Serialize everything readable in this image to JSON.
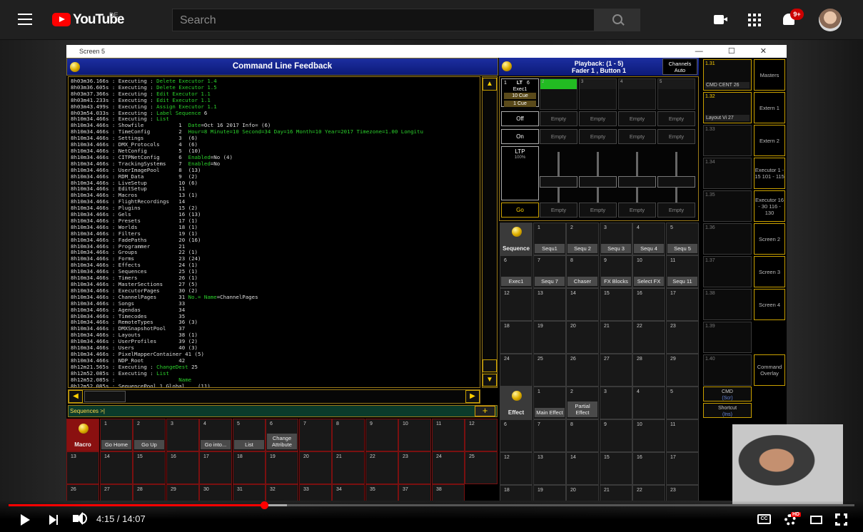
{
  "youtube": {
    "logo_text": "YouTube",
    "logo_country": "DE",
    "search_placeholder": "Search",
    "notification_count": "9+",
    "current_time": "4:15",
    "duration": "14:07",
    "time_display": "4:15 / 14:07",
    "progress": 0.301,
    "buffered": 0.33,
    "hd_badge": "HD",
    "cc_label": "CC"
  },
  "window": {
    "title": "Screen 5",
    "controls": "—  ☐  ✕"
  },
  "command_feedback": {
    "title": "Command Line Feedback",
    "lines": [
      [
        "8h03m36.166s : Executing : ",
        "Delete Executor 1.4",
        ""
      ],
      [
        "8h03m36.605s : Executing : ",
        "Delete Executor 1.5",
        ""
      ],
      [
        "8h03m37.366s : Executing : ",
        "Edit Executor 1.1",
        ""
      ],
      [
        "8h03m41.233s : Executing : ",
        "Edit Executor 1.1",
        ""
      ],
      [
        "8h03m43.499s : Executing : ",
        "Assign Executor 1.1",
        ""
      ],
      [
        "8h03m54.033s : Executing : ",
        "Label Sequence",
        " 6"
      ],
      [
        "8h10m34.466s : Executing : ",
        "List",
        ""
      ],
      [
        "8h10m34.466s : Showfile           1  ",
        "Date",
        "=Oct 16 2017 Info= (6)"
      ],
      [
        "8h10m34.466s : TimeConfig         2  ",
        "Hour=8 Minute=10 Second=34 Day=16 Month=10 Year=2017 Timezone=1.00 Longitu",
        ""
      ],
      [
        "8h10m34.466s : Settings           3  ",
        "",
        "(6)"
      ],
      [
        "8h10m34.466s : DMX_Protocols      4  ",
        "",
        "(6)"
      ],
      [
        "8h10m34.466s : NetConfig          5  ",
        "",
        "(10)"
      ],
      [
        "8h10m34.466s : CITPNetConfig      6  ",
        "Enabled",
        "=No (4)"
      ],
      [
        "8h10m34.466s : TrackingSystems    7  ",
        "Enabled",
        "=No"
      ],
      [
        "8h10m34.466s : UserImagePool      8  ",
        "",
        "(13)"
      ],
      [
        "8h10m34.466s : RDM_Data           9  ",
        "",
        "(2)"
      ],
      [
        "8h10m34.466s : LiveSetup          10 ",
        "",
        "(6)"
      ],
      [
        "8h10m34.466s : EditSetup          11",
        "",
        ""
      ],
      [
        "8h10m34.466s : Macros             13 ",
        "",
        "(1)"
      ],
      [
        "8h10m34.466s : FlightRecordings   14",
        "",
        ""
      ],
      [
        "8h10m34.466s : Plugins            15 ",
        "",
        "(2)"
      ],
      [
        "8h10m34.466s : Gels               16 ",
        "",
        "(13)"
      ],
      [
        "8h10m34.466s : Presets            17 ",
        "",
        "(1)"
      ],
      [
        "8h10m34.466s : Worlds             18 ",
        "",
        "(1)"
      ],
      [
        "8h10m34.466s : Filters            19 ",
        "",
        "(1)"
      ],
      [
        "8h10m34.466s : FadePaths          20 ",
        "",
        "(16)"
      ],
      [
        "8h10m34.466s : Programmer         21",
        "",
        ""
      ],
      [
        "8h10m34.466s : Groups             22 ",
        "",
        "(1)"
      ],
      [
        "8h10m34.466s : Forms              23 ",
        "",
        "(24)"
      ],
      [
        "8h10m34.466s : Effects            24 ",
        "",
        "(1)"
      ],
      [
        "8h10m34.466s : Sequences          25 ",
        "",
        "(1)"
      ],
      [
        "8h10m34.466s : Timers             26 ",
        "",
        "(1)"
      ],
      [
        "8h10m34.466s : MasterSections     27 ",
        "",
        "(5)"
      ],
      [
        "8h10m34.466s : ExecutorPages      30 ",
        "",
        "(2)"
      ],
      [
        "8h10m34.466s : ChannelPages       31 ",
        "No.= Name",
        "=ChannelPages"
      ],
      [
        "8h10m34.466s : Songs              33",
        "",
        ""
      ],
      [
        "8h10m34.466s : Agendas            34",
        "",
        ""
      ],
      [
        "8h10m34.466s : Timecodes          35",
        "",
        ""
      ],
      [
        "8h10m34.466s : RemoteTypes        36 ",
        "",
        "(3)"
      ],
      [
        "8h10m34.466s : DMXSnapshotPool    37",
        "",
        ""
      ],
      [
        "8h10m34.466s : Layouts            38 ",
        "",
        "(1)"
      ],
      [
        "8h10m34.466s : UserProfiles       39 ",
        "",
        "(2)"
      ],
      [
        "8h10m34.466s : Users              40 ",
        "",
        "(3)"
      ],
      [
        "8h10m34.466s : PixelMapperContainer 41 ",
        "",
        "(5)"
      ],
      [
        "8h10m34.466s : NDP_Root           42",
        "",
        ""
      ],
      [
        "8h12m21.565s : Executing : ",
        "ChangeDest",
        " 25"
      ],
      [
        "8h12m52.085s : Executing : ",
        "List",
        ""
      ],
      [
        "8h12m52.085s :                    ",
        "Name",
        ""
      ],
      [
        "8h12m52.085s : SequencePool 1 Global    (11)",
        "",
        ""
      ]
    ],
    "command_prompt": "Sequences >|"
  },
  "macros": {
    "header": "Macro",
    "items": [
      {
        "n": "1",
        "label": "Go Home"
      },
      {
        "n": "2",
        "label": "Go Up"
      },
      {
        "n": "3",
        "label": ""
      },
      {
        "n": "4",
        "label": "Go into..."
      },
      {
        "n": "5",
        "label": "List"
      },
      {
        "n": "6",
        "label": "Change Attribute"
      },
      {
        "n": "7",
        "label": ""
      },
      {
        "n": "8",
        "label": ""
      },
      {
        "n": "9",
        "label": ""
      },
      {
        "n": "10",
        "label": ""
      },
      {
        "n": "11",
        "label": ""
      },
      {
        "n": "12",
        "label": ""
      }
    ],
    "row2": [
      "13",
      "14",
      "15",
      "16",
      "17",
      "18",
      "19",
      "20",
      "21",
      "22",
      "23",
      "24",
      "25"
    ],
    "row3": [
      "26",
      "27",
      "28",
      "29",
      "30",
      "31",
      "32",
      "33",
      "34",
      "35",
      "37",
      "38"
    ]
  },
  "playback": {
    "title_line1": "Playback: (1 - 5)",
    "title_line2": "Fader  1 , Button  1",
    "channels_label": "Channels",
    "channels_mode": "Auto",
    "exec_num": "1",
    "exec_lt": "LT",
    "exec_count": "6",
    "exec_name": "Exec1",
    "exec_cue1": "10 Cue",
    "exec_cue2": "1 Cue",
    "off_label": "Off",
    "on_label": "On",
    "ltp_label": "LTP",
    "ltp_value": "100%",
    "go_label": "Go",
    "empty_label": "Empty",
    "slot_nums": [
      "2",
      "3",
      "4",
      "5"
    ]
  },
  "executors": {
    "sequence_label": "Sequence",
    "effect_label": "Effect",
    "row1": [
      {
        "n": "1",
        "label": "Sequ1"
      },
      {
        "n": "2",
        "label": "Sequ 2"
      },
      {
        "n": "3",
        "label": "Sequ 3"
      },
      {
        "n": "4",
        "label": "Sequ 4"
      },
      {
        "n": "5",
        "label": "Sequ 5"
      }
    ],
    "row2": [
      {
        "n": "6",
        "label": "Exec1"
      },
      {
        "n": "7",
        "label": "Sequ 7"
      },
      {
        "n": "8",
        "label": "Chaser"
      },
      {
        "n": "9",
        "label": "FX Blocks"
      },
      {
        "n": "10",
        "label": "Select FX"
      },
      {
        "n": "11",
        "label": "Sequ 11"
      }
    ],
    "row3": [
      "12",
      "13",
      "14",
      "15",
      "16",
      "17"
    ],
    "row4": [
      "18",
      "19",
      "20",
      "21",
      "22",
      "23"
    ],
    "row5": [
      "24",
      "25",
      "26",
      "27",
      "28",
      "29"
    ],
    "effect_items": [
      {
        "n": "1",
        "label": "Main Effect"
      },
      {
        "n": "2",
        "label": "Partial Effect"
      },
      {
        "n": "3",
        "label": ""
      },
      {
        "n": "4",
        "label": ""
      },
      {
        "n": "5",
        "label": ""
      }
    ],
    "erow1": [
      "6",
      "7",
      "8",
      "9",
      "10",
      "11"
    ],
    "erow2": [
      "12",
      "13",
      "14",
      "15",
      "16",
      "17"
    ],
    "erow3": [
      "18",
      "19",
      "20",
      "21",
      "22",
      "23"
    ]
  },
  "views": {
    "items": [
      {
        "n": "1.31",
        "label": "CMD CENT 26"
      },
      {
        "n": "1.32",
        "label": "Layout Vi 27"
      },
      {
        "n": "1.33",
        "label": ""
      },
      {
        "n": "1.34",
        "label": ""
      },
      {
        "n": "1.35",
        "label": ""
      },
      {
        "n": "1.36",
        "label": ""
      },
      {
        "n": "1.37",
        "label": ""
      },
      {
        "n": "1.38",
        "label": ""
      },
      {
        "n": "1.39",
        "label": ""
      },
      {
        "n": "1.40",
        "label": ""
      }
    ],
    "cmd_label": "CMD",
    "cmd_sub": "(Scr)",
    "shortcut_label": "Shortcut",
    "shortcut_sub": "(Ins)"
  },
  "view_buttons": [
    "Masters",
    "Extern 1",
    "Extern 2",
    "Executor 1 - 15 101 - 115",
    "Executor 16 - 30 116 - 130",
    "Screen 2",
    "Screen 3",
    "Screen 4",
    "",
    "Command Overlay"
  ],
  "colors": {
    "accent": "#c9a000",
    "title_blue": "#1c2ea0",
    "feedback_green": "#2bd02b",
    "active_exec": "#22bb22",
    "yt_red": "#ff0000"
  }
}
